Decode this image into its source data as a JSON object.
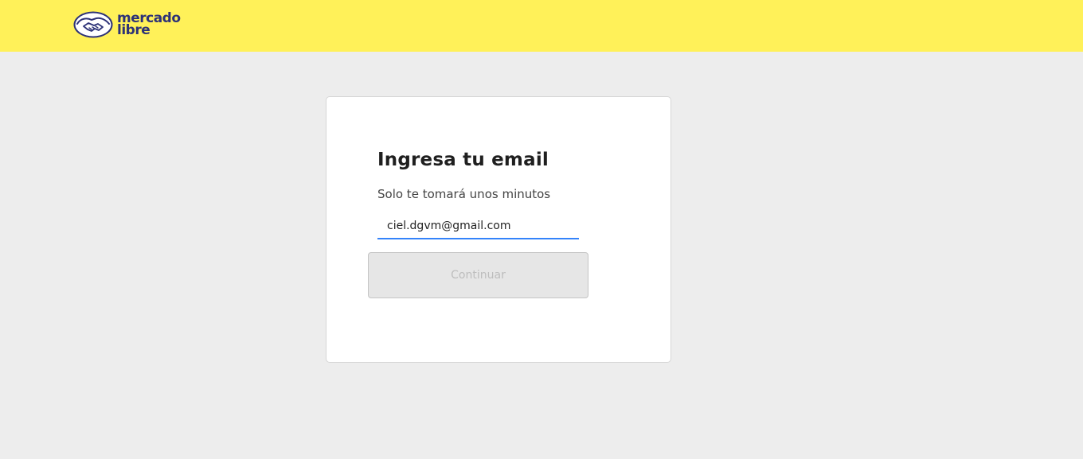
{
  "header": {
    "logo_line1": "mercado",
    "logo_line2": "libre",
    "background_color": "#fff159"
  },
  "card": {
    "title": "Ingresa tu email",
    "subtitle": "Solo te tomará unos minutos",
    "email_value": "ciel.dgvm@gmail.com",
    "continue_label": "Continuar",
    "continue_disabled": true
  },
  "colors": {
    "accent": "#3483fa",
    "page_background": "#ededed",
    "brand_navy": "#2d3277"
  },
  "icons": {
    "logo": "handshake-icon"
  }
}
